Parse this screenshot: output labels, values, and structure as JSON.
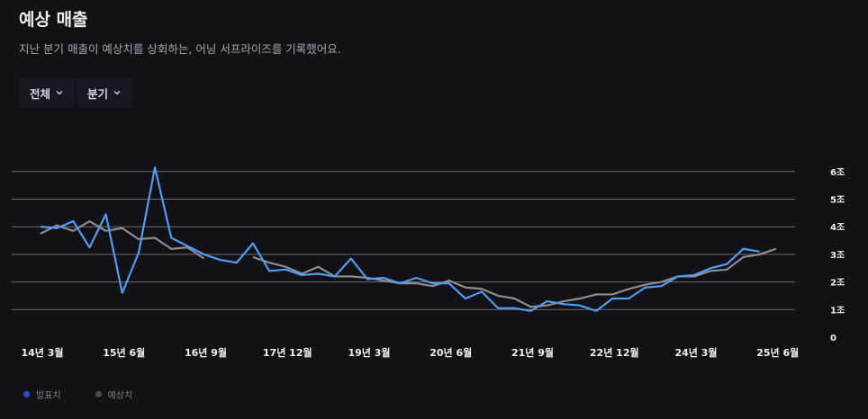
{
  "header": {
    "title": "예상 매출",
    "subtitle": "지난 분기 매출이 예상치를 상회하는, 어닝 서프라이즈를 기록했어요."
  },
  "filters": [
    {
      "label": "전체",
      "icon": "chevron-down-icon"
    },
    {
      "label": "분기",
      "icon": "chevron-down-icon"
    }
  ],
  "colors": {
    "actual": "#4e9cf5",
    "estimate": "#8d8d8d",
    "legend_actual_dot": "#2250c8",
    "legend_estimate_dot": "#4a4a50",
    "grid": "#8a8a90"
  },
  "chart_data": {
    "type": "line",
    "title": "",
    "xlabel": "",
    "ylabel": "",
    "y_unit": "조",
    "ylim": [
      0,
      6.2
    ],
    "y_ticks": [
      0,
      1,
      2,
      3,
      4,
      5,
      6
    ],
    "y_tick_labels": [
      "0",
      "1조",
      "2조",
      "3조",
      "4조",
      "5조",
      "6조"
    ],
    "grid": true,
    "y_axis_position": "right",
    "x_tick_labels": [
      {
        "label": "14년 3월",
        "index": 0
      },
      {
        "label": "15년 6월",
        "index": 5
      },
      {
        "label": "16년 9월",
        "index": 10
      },
      {
        "label": "17년 12월",
        "index": 15
      },
      {
        "label": "19년 3월",
        "index": 20
      },
      {
        "label": "20년 6월",
        "index": 25
      },
      {
        "label": "21년 9월",
        "index": 30
      },
      {
        "label": "22년 12월",
        "index": 35
      },
      {
        "label": "24년 3월",
        "index": 40
      },
      {
        "label": "25년 6월",
        "index": 45
      }
    ],
    "quarters": [
      "14Q1",
      "14Q2",
      "14Q3",
      "14Q4",
      "15Q1",
      "15Q2",
      "15Q3",
      "15Q4",
      "16Q1",
      "16Q2",
      "16Q3",
      "16Q4",
      "17Q1",
      "17Q2",
      "17Q3",
      "17Q4",
      "18Q1",
      "18Q2",
      "18Q3",
      "18Q4",
      "19Q1",
      "19Q2",
      "19Q3",
      "19Q4",
      "20Q1",
      "20Q2",
      "20Q3",
      "20Q4",
      "21Q1",
      "21Q2",
      "21Q3",
      "21Q4",
      "22Q1",
      "22Q2",
      "22Q3",
      "22Q4",
      "23Q1",
      "23Q2",
      "23Q3",
      "23Q4",
      "24Q1",
      "24Q2",
      "24Q3",
      "24Q4",
      "25Q1",
      "25Q2"
    ],
    "legend": "bottom-left",
    "series": [
      {
        "name": "발표치",
        "values": [
          4.0,
          3.95,
          4.2,
          3.25,
          4.45,
          1.6,
          3.05,
          6.15,
          3.6,
          3.3,
          3.0,
          2.8,
          2.7,
          3.4,
          2.4,
          2.45,
          2.25,
          2.3,
          2.2,
          2.85,
          2.1,
          2.15,
          1.95,
          2.15,
          1.95,
          1.95,
          1.4,
          1.65,
          1.05,
          1.05,
          0.95,
          1.3,
          1.2,
          1.15,
          0.95,
          1.4,
          1.4,
          1.8,
          1.85,
          2.2,
          2.25,
          2.5,
          2.65,
          3.2,
          3.1,
          null
        ]
      },
      {
        "name": "예상치",
        "values": [
          3.75,
          4.05,
          3.85,
          4.2,
          3.85,
          3.95,
          3.55,
          3.6,
          3.2,
          3.25,
          2.85,
          null,
          null,
          2.9,
          2.7,
          2.55,
          2.3,
          2.55,
          2.2,
          2.2,
          2.15,
          2.05,
          1.95,
          1.95,
          1.85,
          2.05,
          1.8,
          1.75,
          1.5,
          1.4,
          1.1,
          1.15,
          1.3,
          1.4,
          1.55,
          1.55,
          1.75,
          1.9,
          2.0,
          2.2,
          2.2,
          2.4,
          2.45,
          2.9,
          3.0,
          3.2
        ]
      }
    ]
  }
}
